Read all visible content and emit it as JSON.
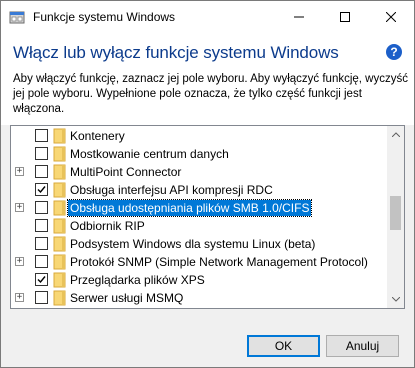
{
  "window": {
    "title": "Funkcje systemu Windows"
  },
  "header": {
    "heading": "Włącz lub wyłącz funkcje systemu Windows",
    "help_glyph": "?",
    "description": "Aby włączyć funkcję, zaznacz jej pole wyboru. Aby wyłączyć funkcję, wyczyść jej pole wyboru. Wypełnione pole oznacza, że tylko część funkcji jest włączona."
  },
  "features": [
    {
      "label": "Kontenery",
      "expandable": false,
      "checked": false
    },
    {
      "label": "Mostkowanie centrum danych",
      "expandable": false,
      "checked": false
    },
    {
      "label": "MultiPoint Connector",
      "expandable": true,
      "checked": false
    },
    {
      "label": "Obsługa interfejsu API kompresji RDC",
      "expandable": false,
      "checked": true
    },
    {
      "label": "Obsługa udostępniania plików SMB 1.0/CIFS",
      "expandable": true,
      "checked": false,
      "selected": true
    },
    {
      "label": "Odbiornik RIP",
      "expandable": false,
      "checked": false
    },
    {
      "label": "Podsystem Windows dla systemu Linux (beta)",
      "expandable": false,
      "checked": false
    },
    {
      "label": "Protokół SNMP (Simple Network Management Protocol)",
      "expandable": true,
      "checked": false
    },
    {
      "label": "Przeglądarka plików XPS",
      "expandable": false,
      "checked": true
    },
    {
      "label": "Serwer usługi MSMQ",
      "expandable": true,
      "checked": false
    }
  ],
  "buttons": {
    "ok": "OK",
    "cancel": "Anuluj"
  },
  "icons": {
    "app": "windows-features-icon",
    "folder": "folder-icon",
    "help": "help-icon"
  },
  "colors": {
    "heading": "#0c3b8c",
    "selection": "#0078d7",
    "folder": "#f8d775"
  }
}
